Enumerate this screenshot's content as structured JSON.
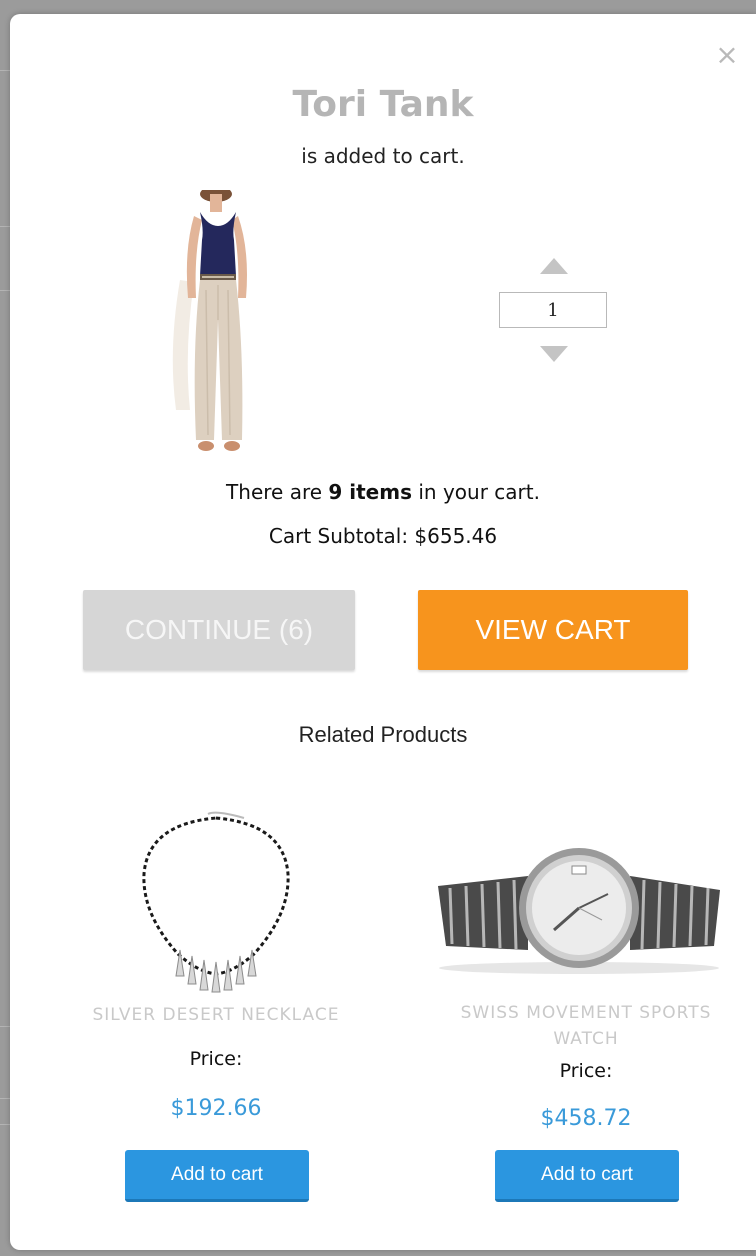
{
  "modal": {
    "close_glyph": "×",
    "product_title": "Tori Tank",
    "subtitle": "is added to cart.",
    "quantity": "1",
    "cart_summary_prefix": "There are ",
    "cart_summary_count": "9 items",
    "cart_summary_suffix": " in your cart.",
    "cart_subtotal": "Cart Subtotal: $655.46",
    "continue_label": "CONTINUE (6)",
    "view_cart_label": "VIEW CART",
    "related_heading": "Related Products"
  },
  "related_products": [
    {
      "name": "SILVER DESERT NECKLACE",
      "price_label": "Price:",
      "price": "$192.66",
      "add_label": "Add to cart"
    },
    {
      "name": "SWISS MOVEMENT SPORTS WATCH",
      "price_label": "Price:",
      "price": "$458.72",
      "add_label": "Add to cart"
    }
  ],
  "colors": {
    "accent_orange": "#f7941d",
    "button_blue": "#2b96e0",
    "price_blue": "#3a9ad9",
    "muted_gray": "#d6d6d6"
  },
  "icons": {
    "close": "close-icon",
    "qty_up": "triangle-up-icon",
    "qty_down": "triangle-down-icon"
  }
}
